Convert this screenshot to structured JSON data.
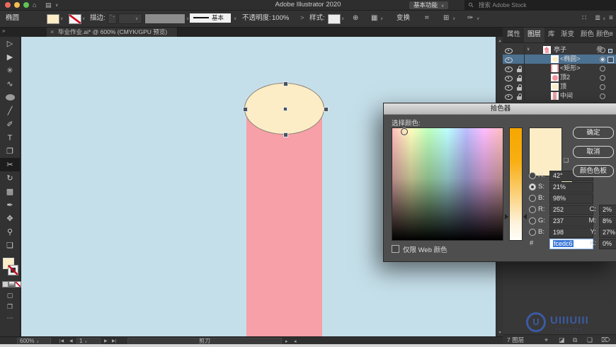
{
  "icons": {
    "chevron_down": "∨",
    "chevron_right": ">",
    "close": "×",
    "expand_double": "»",
    "home": "⌂",
    "layout": "▤",
    "search": "⚲",
    "globe": "⊕",
    "grid": "▦",
    "hash": "⌗",
    "align": "⊞",
    "pen_settings": "✑",
    "dots_grid": "∷",
    "list": "≣",
    "menu": "≡",
    "up_arrow": "▴",
    "down_arrow": "▾",
    "stepper_up": "⌃",
    "stepper_down": "⌄",
    "first": "|◀",
    "prev": "◀",
    "next": "▶",
    "last": "▶|",
    "collapse_left": "▸",
    "collapse_right": "◂",
    "gamut_cube": "❑",
    "ellipsis": "⋯",
    "screen_mode": "❐",
    "draw_mode": "▢",
    "locate": "⌖",
    "mask": "◪",
    "new_sublayer": "⧉",
    "new_layer": "❏",
    "trash": "⌦"
  },
  "titlebar": {
    "title": "Adobe Illustrator 2020",
    "workspace": "基本功能",
    "search_placeholder": "搜索 Adobe Stock"
  },
  "options_bar": {
    "context": "椭圆",
    "stroke_label": "描边:",
    "stroke_style": "基本",
    "opacity_label": "不透明度:",
    "opacity_value": "100%",
    "style_label": "样式:",
    "transform_label": "变换"
  },
  "document_tab": {
    "title": "毕业作业.ai* @ 600% (CMYK/GPU 预览)"
  },
  "toolbar": {
    "tools": [
      {
        "name": "selection-tool",
        "glyph": "▷"
      },
      {
        "name": "direct-selection-tool",
        "glyph": "▶"
      },
      {
        "name": "magic-wand-tool",
        "glyph": "✳"
      },
      {
        "name": "lasso-tool",
        "glyph": "∿"
      },
      {
        "name": "ellipse-tool",
        "glyph": ""
      },
      {
        "name": "line-tool",
        "glyph": "╱"
      },
      {
        "name": "paintbrush-tool",
        "glyph": "✐"
      },
      {
        "name": "type-tool",
        "glyph": "T"
      },
      {
        "name": "free-transform-tool",
        "glyph": "❐"
      },
      {
        "name": "scissors-tool",
        "glyph": "✂",
        "selected": true
      },
      {
        "name": "rotate-tool",
        "glyph": "↻"
      },
      {
        "name": "gradient-tool",
        "glyph": "▩"
      },
      {
        "name": "eyedropper-tool",
        "glyph": "✒"
      },
      {
        "name": "hand-tool",
        "glyph": "✥"
      },
      {
        "name": "zoom-tool",
        "glyph": "⚲"
      },
      {
        "name": "artboard-tool",
        "glyph": "❏"
      }
    ]
  },
  "canvas": {
    "background": "#c5dfea",
    "column_color": "#f7a0a7",
    "ellipse_fill": "#fcedc6",
    "ellipse_stroke": "#8a8273"
  },
  "color_picker": {
    "title": "拾色器",
    "select_color": "选择颜色:",
    "ok": "确定",
    "cancel": "取消",
    "swatches": "颜色色板",
    "web_only": "仅限 Web 颜色",
    "current_color": "#fcedc6",
    "values": {
      "h_label": "H:",
      "h": "42°",
      "s_label": "S:",
      "s": "21%",
      "b_label": "B:",
      "b": "98%",
      "r_label": "R:",
      "r": "252",
      "g_label": "G:",
      "g": "237",
      "b2_label": "B:",
      "b2": "198",
      "hex_prefix": "#",
      "hex": "fcedc6",
      "c_label": "C:",
      "c": "2%",
      "m_label": "M:",
      "m": "8%",
      "y_label": "Y:",
      "y": "27%",
      "k_label": "K:",
      "k": "0%"
    }
  },
  "layers_panel": {
    "tabs": [
      "属性",
      "图层",
      "库",
      "渐变",
      "颜色",
      "颜色参"
    ],
    "rows": [
      {
        "name": "亭子"
      },
      {
        "name": "<椭圆>"
      },
      {
        "name": "<矩形>"
      },
      {
        "name": "顶2"
      },
      {
        "name": "顶"
      },
      {
        "name": "中间"
      }
    ],
    "count": "7 图层"
  },
  "status_bar": {
    "zoom": "600%",
    "artboard": "1",
    "tool": "剪刀"
  },
  "watermark": {
    "logo": "U",
    "text": "UIIIUIII",
    "dots": "▪▪▪▪▪▪▪▪"
  }
}
